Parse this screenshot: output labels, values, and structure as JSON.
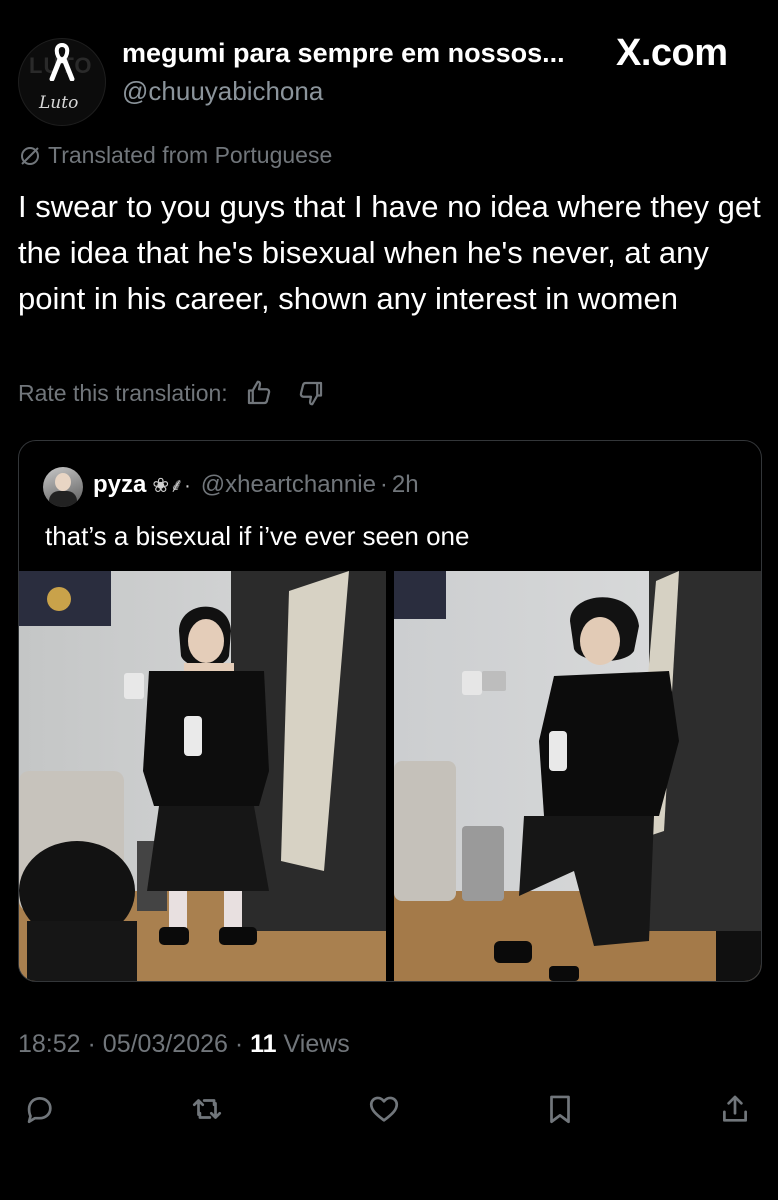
{
  "author": {
    "display_name": "megumi para sempre em nossos...",
    "handle": "@chuuyabichona",
    "avatar_text": "Luto",
    "avatar_watermark": "LUTO"
  },
  "brand": "X.com",
  "translation": {
    "note": "Translated from Portuguese",
    "rate_label": "Rate this translation:"
  },
  "tweet": {
    "text": "I swear to you guys that I have no idea where they get the idea that he's bisexual when he's never, at any point in his career, shown any interest in women"
  },
  "quote": {
    "name": "pyza",
    "decoration": "❀⸙·",
    "handle": "@xheartchannie",
    "separator": "·",
    "time": "2h",
    "text": "that’s a bisexual if i’ve ever seen one"
  },
  "meta": {
    "time": "18:52",
    "separator": "·",
    "date": "05/03/2026",
    "views_count": "11",
    "views_label": "Views"
  },
  "actions": [
    "reply-icon",
    "retweet-icon",
    "like-icon",
    "bookmark-icon",
    "share-icon"
  ],
  "colors": {
    "background": "#000000",
    "text": "#e7e9ea",
    "muted": "#71767b",
    "border": "#333639"
  }
}
